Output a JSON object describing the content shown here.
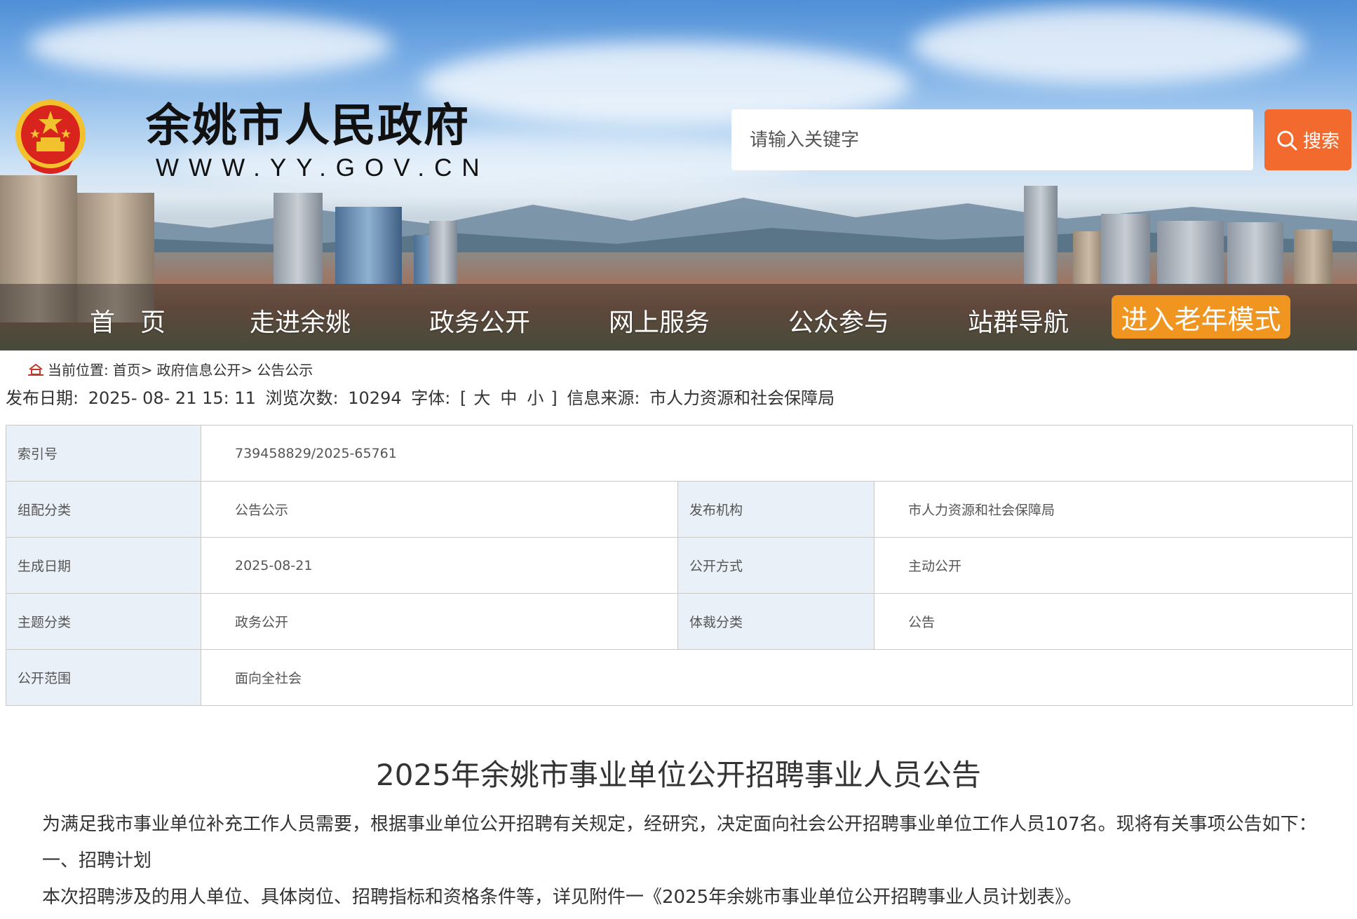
{
  "header": {
    "site_title": "余姚市人民政府",
    "site_url": "WWW.YY.GOV.CN",
    "search_placeholder": "请输入关键字",
    "search_button_label": "搜索"
  },
  "nav": {
    "items": [
      "首　页",
      "走进余姚",
      "政务公开",
      "网上服务",
      "公众参与",
      "站群导航"
    ],
    "elder_mode_label": "进入老年模式"
  },
  "breadcrumb": {
    "prefix": "当前位置:",
    "items": [
      "首页>",
      "政府信息公开>",
      "公告公示"
    ]
  },
  "meta": {
    "publish_date_label": "发布日期:",
    "publish_date": "2025- 08- 21 15: 11",
    "views_label": "浏览次数:",
    "views": "10294",
    "font_label": "字体:",
    "font_open": "[",
    "font_large": "大",
    "font_medium": "中",
    "font_small": "小",
    "font_close": "]",
    "source_label": "信息来源:",
    "source": "市人力资源和社会保障局"
  },
  "info_table": {
    "index_label": "索引号",
    "index_value": "739458829/2025-65761",
    "category_label": "组配分类",
    "category_value": "公告公示",
    "org_label": "发布机构",
    "org_value": "市人力资源和社会保障局",
    "date_label": "生成日期",
    "date_value": "2025-08-21",
    "mode_label": "公开方式",
    "mode_value": "主动公开",
    "topic_label": "主题分类",
    "topic_value": "政务公开",
    "genre_label": "体裁分类",
    "genre_value": "公告",
    "scope_label": "公开范围",
    "scope_value": "面向全社会"
  },
  "article": {
    "title": "2025年余姚市事业单位公开招聘事业人员公告",
    "paragraphs": [
      "为满足我市事业单位补充工作人员需要，根据事业单位公开招聘有关规定，经研究，决定面向社会公开招聘事业单位工作人员107名。现将有关事项公告如下：",
      "一、招聘计划",
      "本次招聘涉及的用人单位、具体岗位、招聘指标和资格条件等，详见附件一《2025年余姚市事业单位公开招聘事业人员计划表》。"
    ]
  },
  "colors": {
    "search_button": "#f36a2f",
    "elder_mode_button": "#f0951f",
    "table_label_bg": "#e9f0f7",
    "emblem_red": "#d8241d",
    "emblem_gold": "#f2c12e"
  },
  "icons": {
    "search": "search-icon",
    "breadcrumb_home": "home-icon",
    "emblem": "national-emblem-icon"
  }
}
